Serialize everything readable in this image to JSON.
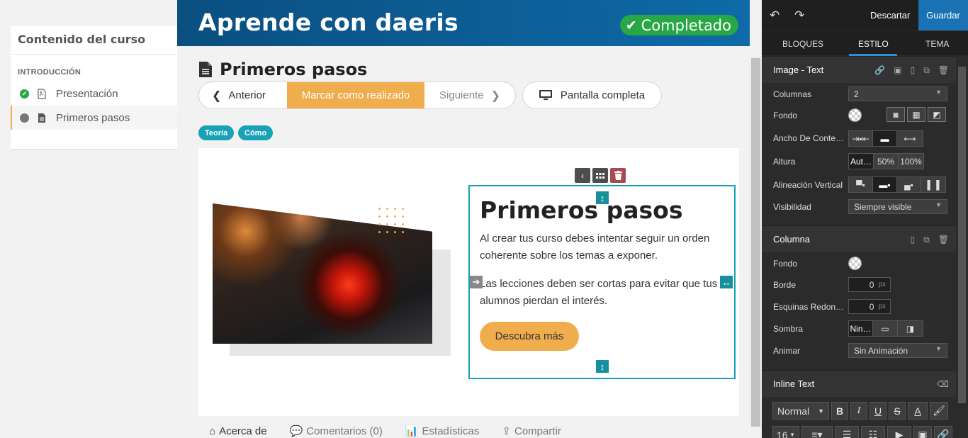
{
  "header": {
    "course_title": "Aprende con daeris",
    "completed_label": "Completado"
  },
  "sidebar": {
    "title": "Contenido del curso",
    "section": "INTRODUCCIÓN",
    "lessons": [
      {
        "label": "Presentación",
        "status": "done"
      },
      {
        "label": "Primeros pasos",
        "status": "current"
      }
    ]
  },
  "lesson": {
    "title": "Primeros pasos",
    "prev_label": "Anterior",
    "done_label": "Marcar como realizado",
    "next_label": "Siguiente",
    "fullscreen_label": "Pantalla completa",
    "tags": [
      "Teoría",
      "Cómo"
    ]
  },
  "content": {
    "heading": "Primeros pasos",
    "paragraph1": "Al crear tus curso debes intentar seguir un orden coherente sobre los temas a exponer.",
    "paragraph2": "Las lecciones deben ser cortas para evitar que tus alumnos pierdan el interés.",
    "button_label": "Descubra más"
  },
  "footer_tabs": [
    "Acerca de",
    "Comentarios (0)",
    "Estadísticas",
    "Compartir"
  ],
  "editor": {
    "discard_label": "Descartar",
    "save_label": "Guardar",
    "tabs": [
      "BLOQUES",
      "ESTILO",
      "TEMA"
    ],
    "image_text": {
      "title": "Image - Text",
      "columns_label": "Columnas",
      "columns_value": "2",
      "background_label": "Fondo",
      "width_label": "Ancho De Conte…",
      "height_label": "Altura",
      "height_options": [
        "Aut…",
        "50%",
        "100%"
      ],
      "valign_label": "Alineación Vertical",
      "visibility_label": "Visibilidad",
      "visibility_value": "Siempre visible"
    },
    "column": {
      "title": "Columna",
      "background_label": "Fondo",
      "border_label": "Borde",
      "border_value": "0",
      "border_unit": "px",
      "radius_label": "Esquinas Redon…",
      "radius_value": "0",
      "radius_unit": "px",
      "shadow_label": "Sombra",
      "shadow_value": "Nin…",
      "animate_label": "Animar",
      "animate_value": "Sin Animación"
    },
    "inline_text": {
      "title": "Inline Text",
      "style_value": "Normal",
      "size_value": "16"
    }
  },
  "colors": {
    "accent": "#f0ad4e",
    "teal": "#17a2b8",
    "green": "#28a745",
    "blue": "#1a72b5"
  }
}
